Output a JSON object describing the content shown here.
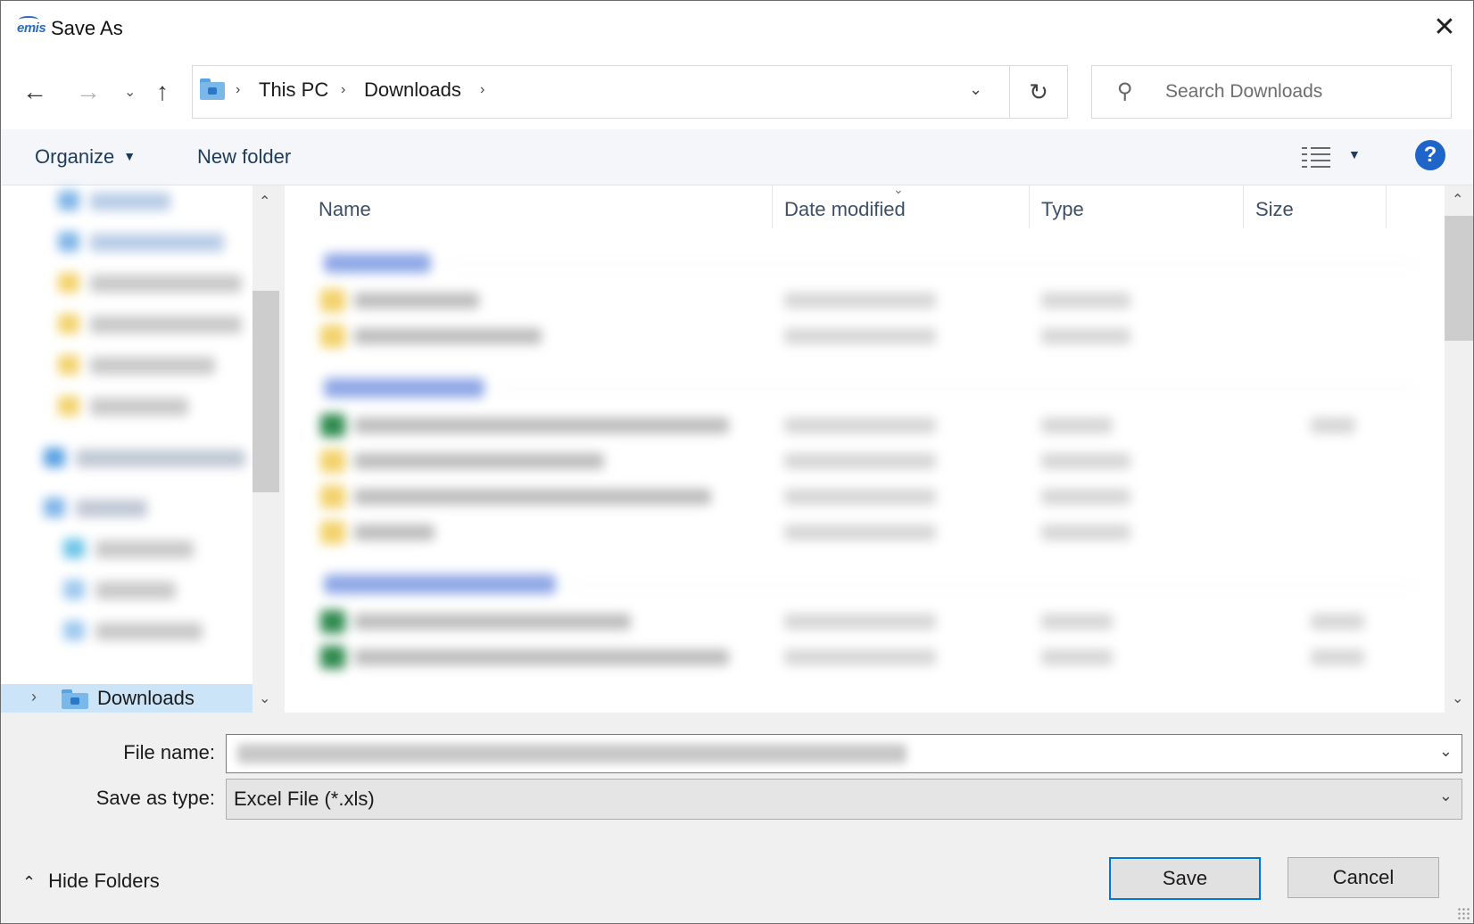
{
  "window": {
    "app_logo": "emis",
    "title": "Save As",
    "close_glyph": "✕"
  },
  "nav": {
    "back_glyph": "←",
    "forward_glyph": "→",
    "recent_glyph": "⌄",
    "up_glyph": "↑",
    "breadcrumbs": [
      "This PC",
      "Downloads"
    ],
    "crumb_separator": "›",
    "address_dropdown_glyph": "⌄",
    "refresh_glyph": "↻"
  },
  "search": {
    "icon": "search-icon",
    "placeholder": "Search Downloads"
  },
  "toolbar": {
    "organize_label": "Organize",
    "organize_caret": "▼",
    "new_folder_label": "New folder",
    "view_caret": "▼",
    "help_label": "?"
  },
  "navpane": {
    "selected_item_label": "Downloads",
    "selected_chevron": "›",
    "scroll_up": "⌃",
    "scroll_down": "⌄"
  },
  "filelist": {
    "columns": [
      "Name",
      "Date modified",
      "Type",
      "Size"
    ],
    "sort_caret": "⌄",
    "scroll_up": "⌃",
    "scroll_down": "⌄"
  },
  "form": {
    "file_name_label": "File name:",
    "save_as_type_label": "Save as type:",
    "save_as_type_value": "Excel File (*.xls)",
    "combo_glyph": "⌄"
  },
  "footer": {
    "hide_folders_label": "Hide Folders",
    "hide_folders_glyph": "⌃",
    "save_label": "Save",
    "cancel_label": "Cancel"
  },
  "colors": {
    "accent": "#0078d7",
    "help_blue": "#1f64c8",
    "selection": "#cce4f7"
  }
}
